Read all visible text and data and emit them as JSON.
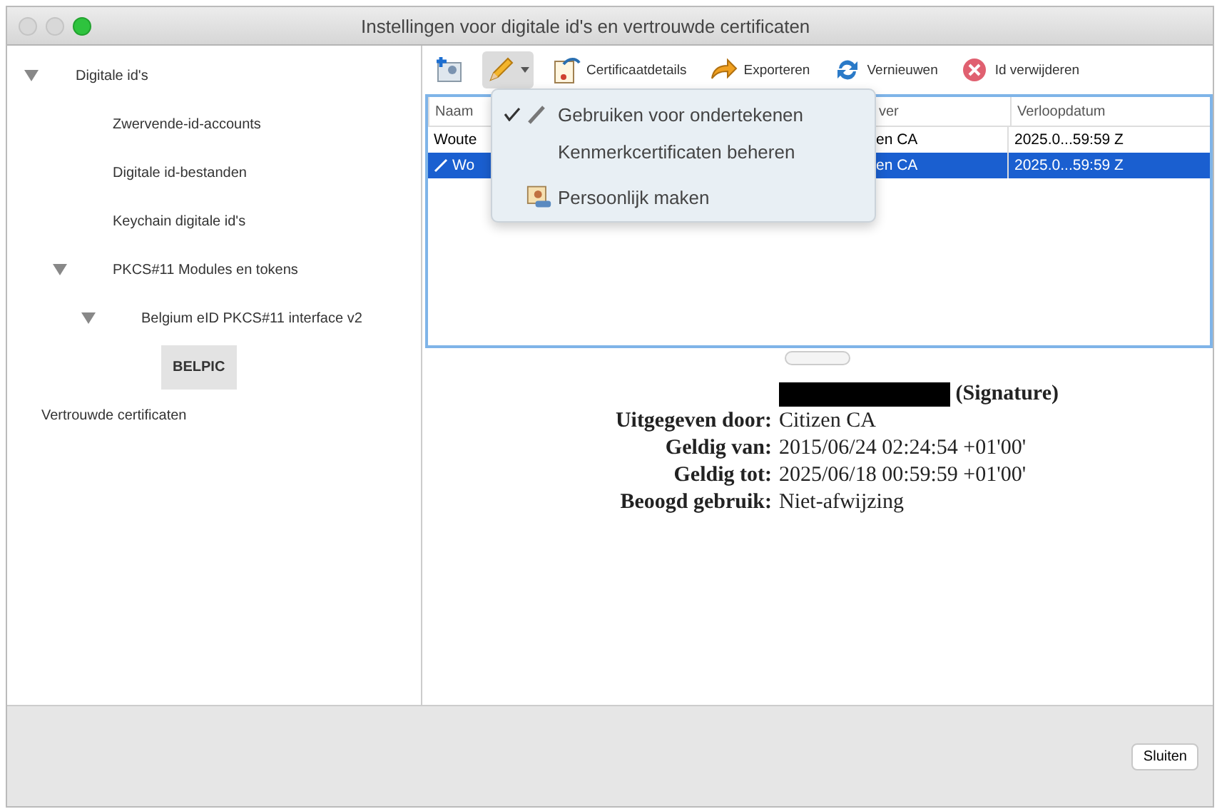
{
  "window": {
    "title": "Instellingen voor digitale id's en vertrouwde certificaten"
  },
  "sidebar": {
    "items": [
      {
        "label": "Digitale id's",
        "expanded": true,
        "selected": false,
        "children": [
          {
            "label": "Zwervende-id-accounts",
            "selected": false
          },
          {
            "label": "Digitale id-bestanden",
            "selected": false
          },
          {
            "label": "Keychain digitale id's",
            "selected": false
          },
          {
            "label": "PKCS#11 Modules en tokens",
            "expanded": true,
            "selected": false,
            "children": [
              {
                "label": "Belgium eID PKCS#11 interface v2",
                "expanded": true,
                "selected": false,
                "children": [
                  {
                    "label": "BELPIC",
                    "selected": true
                  }
                ]
              }
            ]
          }
        ]
      },
      {
        "label": "Vertrouwde certificaten",
        "selected": false
      }
    ]
  },
  "toolbar": [
    {
      "kind": "add",
      "pressed": false
    },
    {
      "kind": "pen",
      "pressed": true
    },
    {
      "kind": "details",
      "label": "Certificaatdetails",
      "pressed": false
    },
    {
      "kind": "export",
      "label": "Exporteren",
      "pressed": false
    },
    {
      "kind": "refresh",
      "label": "Vernieuwen",
      "pressed": false
    },
    {
      "kind": "remove",
      "label": "Id verwijderen",
      "pressed": false
    }
  ],
  "table": {
    "columns": [
      "Naam",
      "ver",
      "Verloopdatum"
    ],
    "rows": [
      {
        "selected": false,
        "signing": false,
        "cells": [
          "Woute",
          "en CA",
          "2025.0...59:59 Z"
        ]
      },
      {
        "selected": true,
        "signing": true,
        "cells": [
          "Wo",
          "en CA",
          "2025.0...59:59 Z"
        ]
      }
    ]
  },
  "menu": {
    "items": [
      {
        "label": "Gebruiken voor ondertekenen",
        "checked": true,
        "kind": "pen"
      },
      {
        "label": "Kenmerkcertificaten beheren",
        "checked": false,
        "kind": "plain"
      },
      {
        "label": "Persoonlijk maken",
        "checked": false,
        "kind": "person"
      }
    ]
  },
  "details": {
    "title": "(Signature)",
    "fields": [
      {
        "label": "Uitgegeven door:",
        "value": "Citizen CA"
      },
      {
        "label": "Geldig van:",
        "value": "2015/06/24 02:24:54 +01'00'"
      },
      {
        "label": "Geldig tot:",
        "value": "2025/06/18 00:59:59 +01'00'"
      },
      {
        "label": "Beoogd gebruik:",
        "value": "Niet-afwijzing"
      }
    ]
  },
  "buttons": [
    {
      "label": "Sluiten"
    }
  ]
}
